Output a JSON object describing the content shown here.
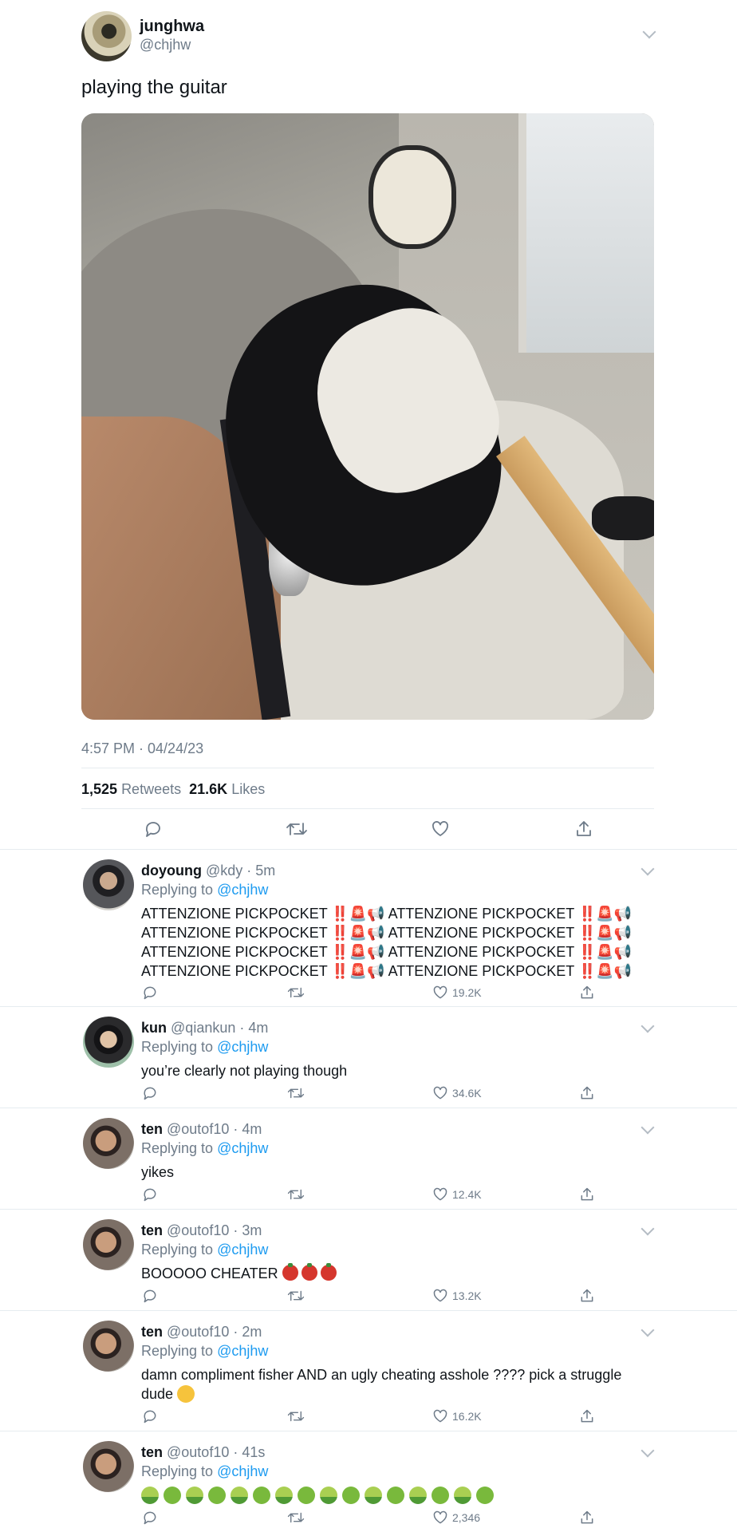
{
  "tweet": {
    "name": "junghwa",
    "handle": "@chjhw",
    "text": "playing the guitar",
    "timestamp": "4:57 PM · 04/24/23",
    "retweets_count": "1,525",
    "retweets_label": "Retweets",
    "likes_count": "21.6K",
    "likes_label": "Likes"
  },
  "replying_to_label": "Replying to",
  "replies": [
    {
      "name": "doyoung",
      "meta": "@kdy · 5m",
      "mention": "@chjhw",
      "lines": [
        "ATTENZIONE PICKPOCKET ‼️🚨📢 ATTENZIONE PICKPOCKET ‼️🚨📢",
        "ATTENZIONE PICKPOCKET ‼️🚨📢 ATTENZIONE PICKPOCKET ‼️🚨📢",
        "ATTENZIONE PICKPOCKET ‼️🚨📢 ATTENZIONE PICKPOCKET ‼️🚨📢",
        "ATTENZIONE PICKPOCKET ‼️🚨📢 ATTENZIONE PICKPOCKET ‼️🚨📢"
      ],
      "likes": "19.2K"
    },
    {
      "name": "kun",
      "meta": "@qiankun · 4m",
      "mention": "@chjhw",
      "text": "you’re clearly not playing though",
      "likes": "34.6K"
    },
    {
      "name": "ten",
      "meta": "@outof10 · 4m",
      "mention": "@chjhw",
      "text": "yikes",
      "likes": "12.4K"
    },
    {
      "name": "ten",
      "meta": "@outof10 · 3m",
      "mention": "@chjhw",
      "text": "BOOOOO CHEATER",
      "likes": "13.2K"
    },
    {
      "name": "ten",
      "meta": "@outof10 · 2m",
      "mention": "@chjhw",
      "text": "damn compliment fisher AND an ugly cheating asshole ???? pick a struggle dude",
      "likes": "16.2K"
    },
    {
      "name": "ten",
      "meta": "@outof10 · 41s",
      "mention": "@chjhw",
      "likes": "2,346"
    }
  ],
  "icons": {
    "reply": "comment-icon",
    "retweet": "retweet-icon",
    "like": "heart-icon",
    "share": "share-icon",
    "more": "chevron-down-icon"
  },
  "colors": {
    "link": "#1d9bf0",
    "secondary_text": "#6e7b89",
    "divider": "#e6ecf0"
  }
}
